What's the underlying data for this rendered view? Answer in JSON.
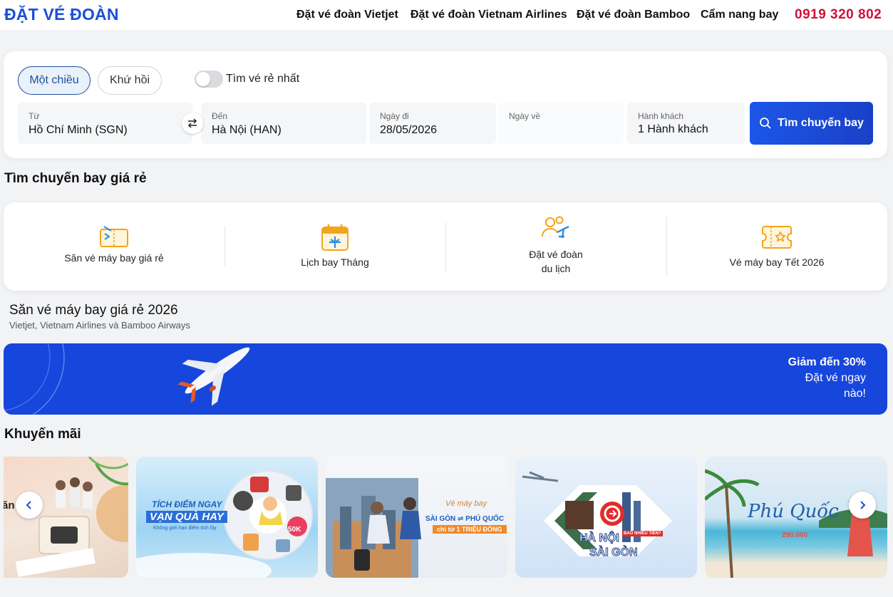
{
  "header": {
    "logo": "ĐẶT VÉ ĐOÀN",
    "nav": [
      "Đặt vé đoàn Vietjet",
      "Đặt vé đoàn Vietnam Airlines",
      "Đặt vé đoàn Bamboo",
      "Cẩm nang bay"
    ],
    "phone": "0919 320 802"
  },
  "search": {
    "trip_types": [
      "Một chiều",
      "Khứ hồi"
    ],
    "cheapest_label": "Tìm vé rẻ nhất",
    "from_label": "Từ",
    "from_value": "Hồ Chí Minh (SGN)",
    "to_label": "Đến",
    "to_value": "Hà Nội (HAN)",
    "depart_label": "Ngày đi",
    "depart_value": "28/05/2026",
    "return_label": "Ngày về",
    "passengers_label": "Hành khách",
    "passengers_value": "1 Hành khách",
    "button": "Tìm chuyến bay"
  },
  "cheap_section": {
    "title": "Tìm chuyến bay giá rẻ",
    "items": [
      {
        "label": "Săn vé máy bay giá rẻ",
        "icon": "ticket-icon"
      },
      {
        "label": "Lịch bay Tháng",
        "icon": "calendar-plane-icon"
      },
      {
        "label_line1": "Đặt vé đoàn",
        "label_line2": "du lịch",
        "icon": "group-plane-icon"
      },
      {
        "label": "Vé máy bay Tết 2026",
        "icon": "tet-ticket-icon"
      }
    ]
  },
  "hunt_section": {
    "title": "Săn vé máy bay giá rẻ 2026",
    "subtitle": "Vietjet, Vietnam Airlines và Bamboo Airways"
  },
  "banner": {
    "line1": "Giảm đến 30%",
    "line2": "Đặt vé ngay",
    "line3": "nào!"
  },
  "promo": {
    "title": "Khuyến mãi",
    "cards": [
      {
        "text": "ăn vé"
      },
      {
        "line1": "TÍCH ĐIỂM NGAY",
        "line2": "VẠN QUÀ HAY",
        "line3": "Không giới hạn điểm tích lũy",
        "badge": "50K"
      },
      {
        "line1": "Vé máy bay",
        "line2": "SÀI GÒN ⇌ PHÚ QUỐC",
        "line3": "chỉ từ 1 TRIỆU ĐỒNG"
      },
      {
        "line1": "HÀ NỘI",
        "line2": "SÀI GÒN",
        "line3": "BAO NHIÊU TIỀN?"
      },
      {
        "line1": "Phú Quốc",
        "line2": "290.000"
      }
    ]
  },
  "colors": {
    "brand_blue": "#1a4fd8",
    "phone_red": "#d0103a",
    "icon_orange": "#f2a51a",
    "icon_blue": "#2f8fe0"
  }
}
